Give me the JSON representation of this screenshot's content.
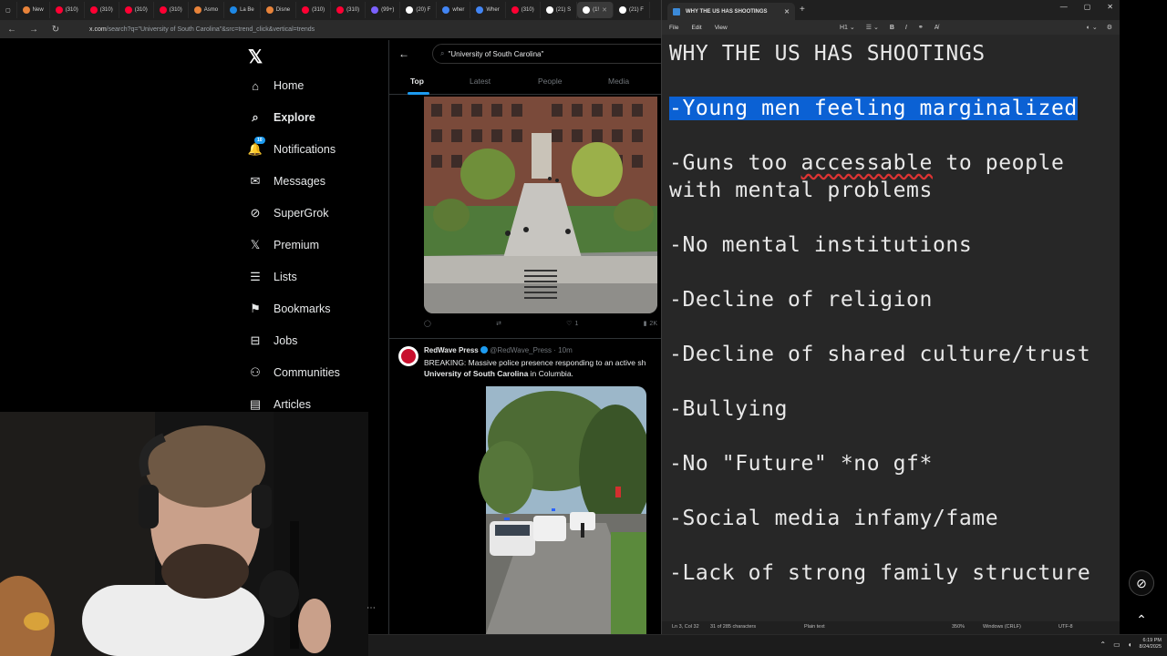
{
  "browser": {
    "tabs": [
      {
        "label": "New",
        "color": "#e8833a"
      },
      {
        "label": "(310)",
        "color": "#ff0033"
      },
      {
        "label": "(310)",
        "color": "#ff0033"
      },
      {
        "label": "(310)",
        "color": "#ff0033"
      },
      {
        "label": "(310)",
        "color": "#ff0033"
      },
      {
        "label": "Asmo",
        "color": "#e8833a"
      },
      {
        "label": "La Be",
        "color": "#1e88e5"
      },
      {
        "label": "Disne",
        "color": "#e8833a"
      },
      {
        "label": "(310)",
        "color": "#ff0033"
      },
      {
        "label": "(310)",
        "color": "#ff0033"
      },
      {
        "label": "(99+)",
        "color": "#7b61ff"
      },
      {
        "label": "(20) F",
        "color": "#ffffff"
      },
      {
        "label": "wher",
        "color": "#4285f4"
      },
      {
        "label": "Wher",
        "color": "#4285f4"
      },
      {
        "label": "(310)",
        "color": "#ff0033"
      },
      {
        "label": "(21) S",
        "color": "#ffffff"
      },
      {
        "label": "(1!",
        "color": "#ffffff"
      },
      {
        "label": "(21) F",
        "color": "#ffffff"
      }
    ],
    "url_domain": "x.com",
    "url_path": "/search?q=\"University of South Carolina\"&src=trend_click&vertical=trends"
  },
  "sidebar": {
    "logo": "𝕏",
    "items": [
      {
        "label": "Home",
        "icon": "⌂",
        "bold": false
      },
      {
        "label": "Explore",
        "icon": "⌕",
        "bold": true
      },
      {
        "label": "Notifications",
        "icon": "🔔",
        "bold": false,
        "badge": "10"
      },
      {
        "label": "Messages",
        "icon": "✉",
        "bold": false
      },
      {
        "label": "SuperGrok",
        "icon": "⊘",
        "bold": false
      },
      {
        "label": "Premium",
        "icon": "𝕏",
        "bold": false
      },
      {
        "label": "Lists",
        "icon": "☰",
        "bold": false
      },
      {
        "label": "Bookmarks",
        "icon": "⚑",
        "bold": false
      },
      {
        "label": "Jobs",
        "icon": "⊟",
        "bold": false
      },
      {
        "label": "Communities",
        "icon": "⚇",
        "bold": false
      },
      {
        "label": "Articles",
        "icon": "▤",
        "bold": false
      }
    ]
  },
  "search": {
    "query": "\"University of South Carolina\"",
    "tabs": [
      "Top",
      "Latest",
      "People",
      "Media"
    ]
  },
  "tweet1": {
    "likes": "1",
    "views": "2K"
  },
  "tweet2": {
    "name": "RedWave Press",
    "handle": "@RedWave_Press",
    "time": "· 10m",
    "text_line1": "BREAKING: Massive police presence responding to an active sh",
    "text_bold": "University of South Carolina",
    "text_line2_rest": " in Columbia."
  },
  "notepad": {
    "tab_title": "WHY THE US HAS SHOOTINGS",
    "menu": [
      "File",
      "Edit",
      "View"
    ],
    "heading_level": "H1",
    "lines": {
      "title": "WHY THE US HAS SHOOTINGS",
      "l1": "-Young men feeling marginalized",
      "l2a": "-Guns too ",
      "l2b": "accessable",
      "l2c": " to people with mental problems",
      "l3": "-No mental institutions",
      "l4": "-Decline of religion",
      "l5": "-Decline of shared culture/trust",
      "l6": "-Bullying",
      "l7": "-No \"Future\" *no gf*",
      "l8": "-Social media infamy/fame",
      "l9": "-Lack of strong family structure"
    },
    "status": {
      "position": "Ln 3, Col 32",
      "chars": "31 of 285 characters",
      "format": "Plain text",
      "zoom": "350%",
      "line_ending": "Windows (CRLF)",
      "encoding": "UTF-8"
    }
  },
  "taskbar": {
    "time": "6:19 PM",
    "date": "8/24/2025"
  },
  "colors": {
    "selection": "#0b61d4",
    "x_blue": "#1d9bf0",
    "background": "#000000"
  }
}
